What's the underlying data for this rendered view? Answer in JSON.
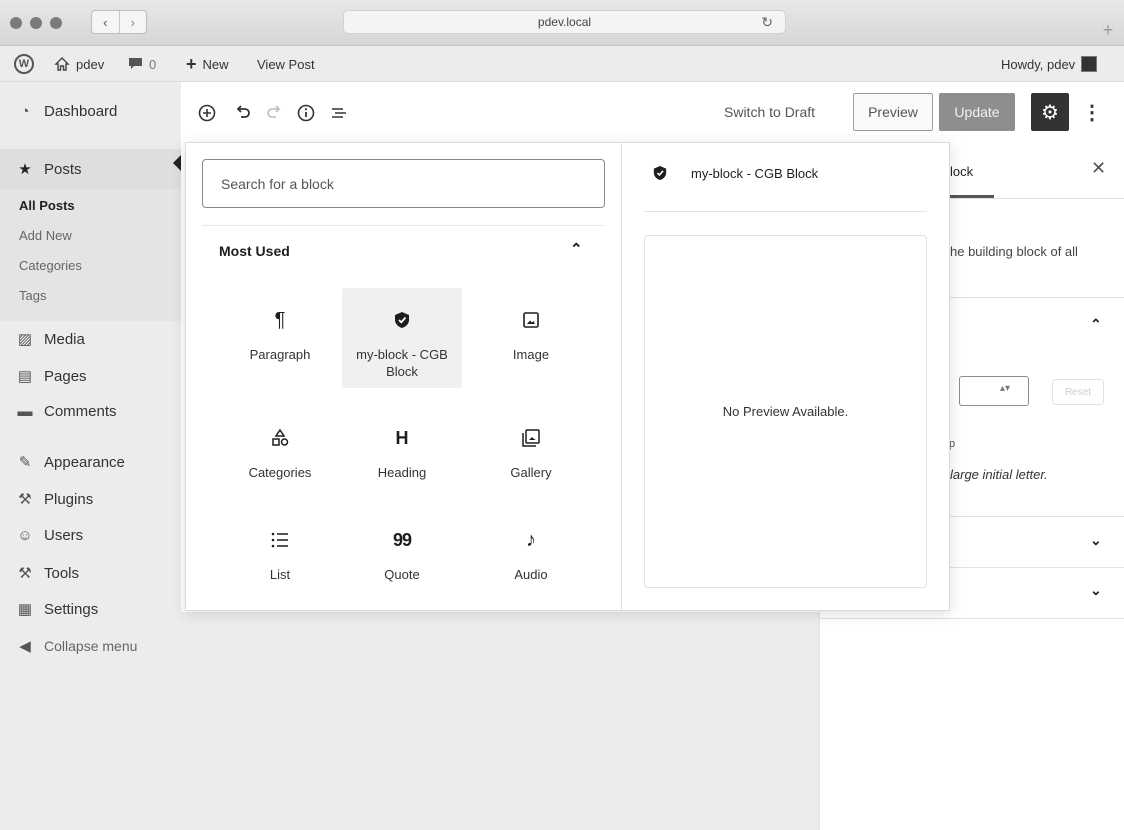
{
  "browser": {
    "url": "pdev.local",
    "reload_icon": "reload-icon",
    "new_tab_label": "+"
  },
  "admin_bar": {
    "site_name": "pdev",
    "comments_count": "0",
    "new_label": "New",
    "view_post_label": "View Post",
    "howdy_label": "Howdy, pdev"
  },
  "admin_menu": {
    "dashboard": "Dashboard",
    "posts": "Posts",
    "posts_sub": [
      "All Posts",
      "Add New",
      "Categories",
      "Tags"
    ],
    "media": "Media",
    "pages": "Pages",
    "comments": "Comments",
    "appearance": "Appearance",
    "plugins": "Plugins",
    "users": "Users",
    "tools": "Tools",
    "settings": "Settings",
    "collapse": "Collapse menu"
  },
  "toolbar": {
    "switch_to_draft": "Switch to Draft",
    "preview": "Preview",
    "update": "Update"
  },
  "inserter": {
    "search_placeholder": "Search for a block",
    "panel_title": "Most Used",
    "blocks": [
      {
        "label": "Paragraph",
        "icon": "paragraph-icon"
      },
      {
        "label": "my-block - CGB Block",
        "icon": "shield-icon"
      },
      {
        "label": "Image",
        "icon": "image-icon"
      },
      {
        "label": "Categories",
        "icon": "categories-icon"
      },
      {
        "label": "Heading",
        "icon": "heading-icon"
      },
      {
        "label": "Gallery",
        "icon": "gallery-icon"
      },
      {
        "label": "List",
        "icon": "list-icon"
      },
      {
        "label": "Quote",
        "icon": "quote-icon"
      },
      {
        "label": "Audio",
        "icon": "audio-icon"
      }
    ],
    "preview_title": "my-block - CGB Block",
    "no_preview": "No Preview Available."
  },
  "sidebar": {
    "tab_partial": "lock",
    "description_partial": "he building block of all",
    "reset": "Reset",
    "small_partial": "p",
    "italic_partial": "large initial letter."
  },
  "colors": {
    "admin_bg": "#ececec",
    "update_button": "#8e8e8e",
    "settings_button": "#333333"
  }
}
